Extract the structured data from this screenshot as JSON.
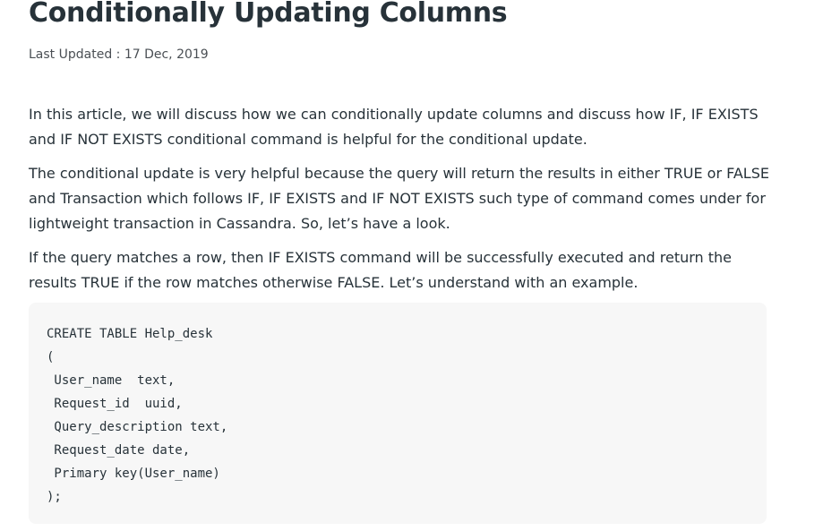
{
  "article": {
    "title": "Conditionally Updating Columns",
    "meta": {
      "label": "Last Updated : ",
      "date": "17 Dec, 2019"
    },
    "paragraphs": [
      "In this article, we will discuss how we can conditionally update columns and discuss how IF, IF EXISTS and IF NOT EXISTS conditional command is helpful for the conditional update.",
      "The conditional update is very helpful because the query will return the results in either TRUE or FALSE and Transaction which follows IF, IF EXISTS and IF NOT EXISTS such type of command comes under for lightweight transaction in Cassandra. So, let’s have a look.",
      "If the query matches a row, then IF EXISTS command will be successfully executed and return the results TRUE if the row matches otherwise FALSE. Let’s understand with an example."
    ],
    "code_lines": [
      "CREATE TABLE Help_desk",
      "(",
      " User_name  text,",
      " Request_id  uuid,",
      " Query_description text,",
      " Request_date date,",
      " Primary key(User_name)",
      ");"
    ]
  }
}
